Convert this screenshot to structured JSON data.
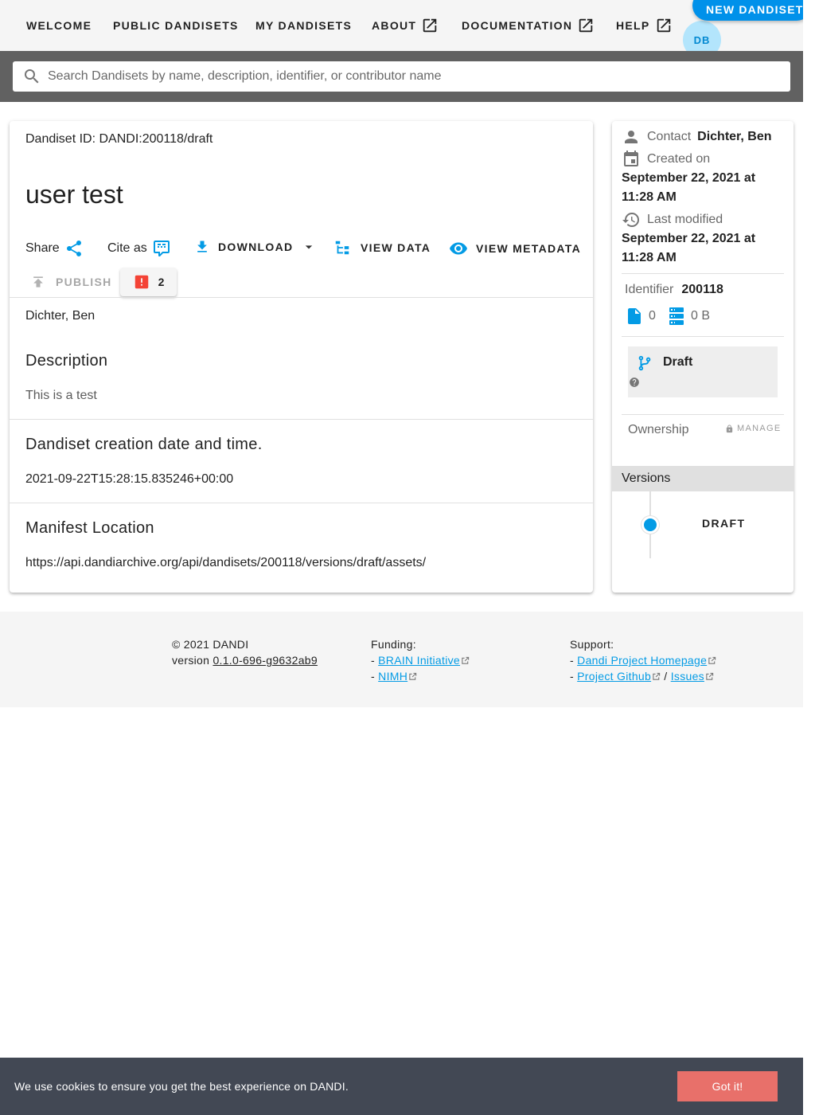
{
  "nav": {
    "welcome": "Welcome",
    "public_dandisets": "Public Dandisets",
    "my_dandisets": "My Dandisets",
    "about": "About",
    "documentation": "Documentation",
    "help": "Help",
    "new_dandiset": "New Dandiset",
    "avatar_initials": "DB"
  },
  "search": {
    "placeholder": "Search Dandisets by name, description, identifier, or contributor name",
    "value": ""
  },
  "dandiset": {
    "id_line": "Dandiset ID: DANDI:200118/draft",
    "title": "user test",
    "contributor": "Dichter, Ben",
    "description_title": "Description",
    "description": "This is a test",
    "created_title": "Dandiset creation date and time.",
    "created_value": "2021-09-22T15:28:15.835246+00:00",
    "manifest_title": "Manifest Location",
    "manifest_value": "https://api.dandiarchive.org/api/dandisets/200118/versions/draft/assets/"
  },
  "actions": {
    "share": "Share",
    "cite_as": "Cite as",
    "download": "Download",
    "view_data": "View Data",
    "view_metadata": "View Metadata",
    "publish": "Publish",
    "error_count": "2"
  },
  "side": {
    "contact_label": "Contact",
    "contact_value": "Dichter, Ben",
    "created_label": "Created on",
    "created_value": "September 22, 2021 at 11:28 AM",
    "modified_label": "Last modified",
    "modified_value": "September 22, 2021 at 11:28 AM",
    "identifier_label": "Identifier",
    "identifier_value": "200118",
    "file_count": "0",
    "size": "0 B",
    "version_status": "Draft",
    "ownership_label": "Ownership",
    "manage": "Manage",
    "versions_label": "Versions",
    "version_item": "Draft"
  },
  "footer": {
    "copyright": "© 2021 DANDI",
    "version_label": "version",
    "version_value": "0.1.0-696-g9632ab9",
    "funding_label": "Funding:",
    "funding_links": [
      "BRAIN Initiative",
      "NIMH"
    ],
    "support_label": "Support:",
    "support_links": [
      "Dandi Project Homepage",
      "Project Github",
      "Issues"
    ],
    "dash": "-",
    "slash": "/"
  },
  "cookie": {
    "text": "We use cookies to ensure you get the best experience on DANDI.",
    "button": "Got it!"
  },
  "colors": {
    "accent": "#0091ea",
    "link": "#039be5",
    "error": "#f44336",
    "cookie_bg": "#424854",
    "cookie_button": "#e8706a"
  },
  "icons": [
    "open-in-new-icon",
    "magnify-icon",
    "share-variant-icon",
    "comment-quote-icon",
    "download-icon",
    "menu-down-icon",
    "file-tree-icon",
    "eye-icon",
    "upload-icon",
    "alert-box-icon",
    "account-icon",
    "calendar-icon",
    "history-icon",
    "file-document-icon",
    "database-icon",
    "source-branch-icon",
    "help-circle-icon",
    "lock-icon",
    "external-link-icon"
  ]
}
